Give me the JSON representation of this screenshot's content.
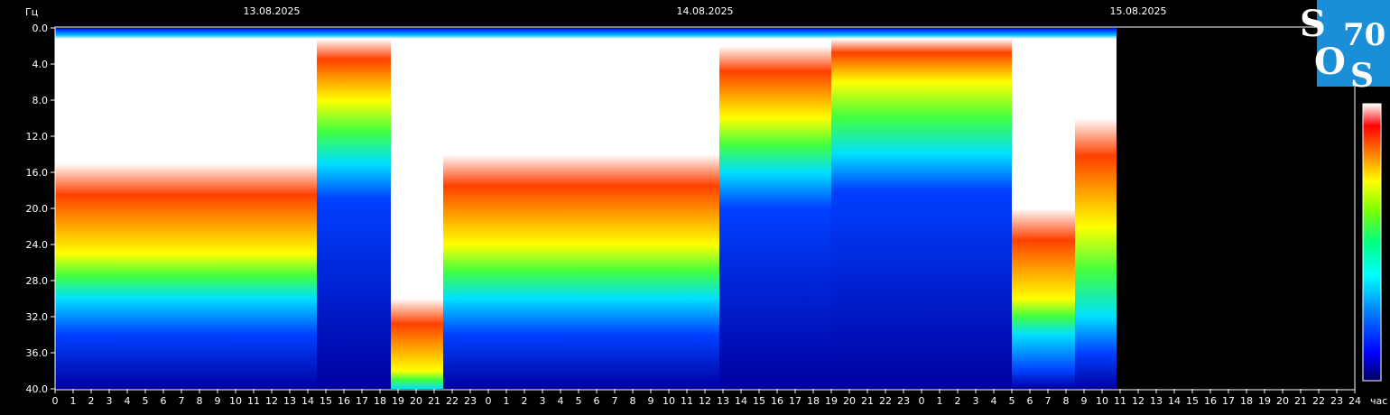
{
  "chart_data": {
    "type": "heatmap",
    "title": "",
    "y_unit_label": "Гц",
    "x_unit_label": "час",
    "y_range": [
      0,
      40
    ],
    "y_ticks": [
      "0.0",
      "4.0",
      "8.0",
      "12.0",
      "16.0",
      "20.0",
      "24.0",
      "28.0",
      "32.0",
      "36.0",
      "40.0"
    ],
    "dates": [
      {
        "label": "13.08.2025",
        "offset_hours": 0
      },
      {
        "label": "14.08.2025",
        "offset_hours": 24
      },
      {
        "label": "15.08.2025",
        "offset_hours": 48
      }
    ],
    "x_tick_labels": [
      "0",
      "1",
      "2",
      "3",
      "4",
      "5",
      "6",
      "7",
      "8",
      "9",
      "10",
      "11",
      "12",
      "13",
      "14",
      "15",
      "16",
      "17",
      "18",
      "19",
      "20",
      "21",
      "22",
      "23",
      "0",
      "1",
      "2",
      "3",
      "4",
      "5",
      "6",
      "7",
      "8",
      "9",
      "10",
      "11",
      "12",
      "13",
      "14",
      "15",
      "16",
      "17",
      "18",
      "19",
      "20",
      "21",
      "22",
      "23",
      "0",
      "1",
      "2",
      "3",
      "4",
      "5",
      "6",
      "7",
      "8",
      "9",
      "10",
      "11",
      "12",
      "13",
      "14",
      "15",
      "16",
      "17",
      "18",
      "19",
      "20",
      "21",
      "22",
      "23",
      "24"
    ],
    "total_hours": 72,
    "data_end_hour": 58.8,
    "segments": [
      {
        "from": 0.0,
        "to": 14.5,
        "white_to_hz": 15,
        "warm_to_hz": 25,
        "green_to_hz": 30
      },
      {
        "from": 14.5,
        "to": 18.6,
        "white_to_hz": 1,
        "warm_to_hz": 8,
        "green_to_hz": 15
      },
      {
        "from": 18.6,
        "to": 21.5,
        "white_to_hz": 30,
        "warm_to_hz": 38,
        "green_to_hz": 40
      },
      {
        "from": 21.5,
        "to": 36.8,
        "white_to_hz": 14,
        "warm_to_hz": 24,
        "green_to_hz": 30
      },
      {
        "from": 36.8,
        "to": 43.0,
        "white_to_hz": 2,
        "warm_to_hz": 10,
        "green_to_hz": 16
      },
      {
        "from": 43.0,
        "to": 53.0,
        "white_to_hz": 1,
        "warm_to_hz": 6,
        "green_to_hz": 14
      },
      {
        "from": 53.0,
        "to": 56.5,
        "white_to_hz": 20,
        "warm_to_hz": 30,
        "green_to_hz": 34
      },
      {
        "from": 56.5,
        "to": 58.8,
        "white_to_hz": 10,
        "warm_to_hz": 22,
        "green_to_hz": 32
      }
    ],
    "colorscale": [
      "#000060",
      "#0000ff",
      "#0080ff",
      "#00ffff",
      "#00ff80",
      "#80ff00",
      "#ffff00",
      "#ff8000",
      "#ff0000",
      "#ffffff"
    ]
  },
  "logo": {
    "s1": "S",
    "o": "O",
    "s2": "S",
    "num": "70",
    "bg_color": "#1a8fd8"
  }
}
